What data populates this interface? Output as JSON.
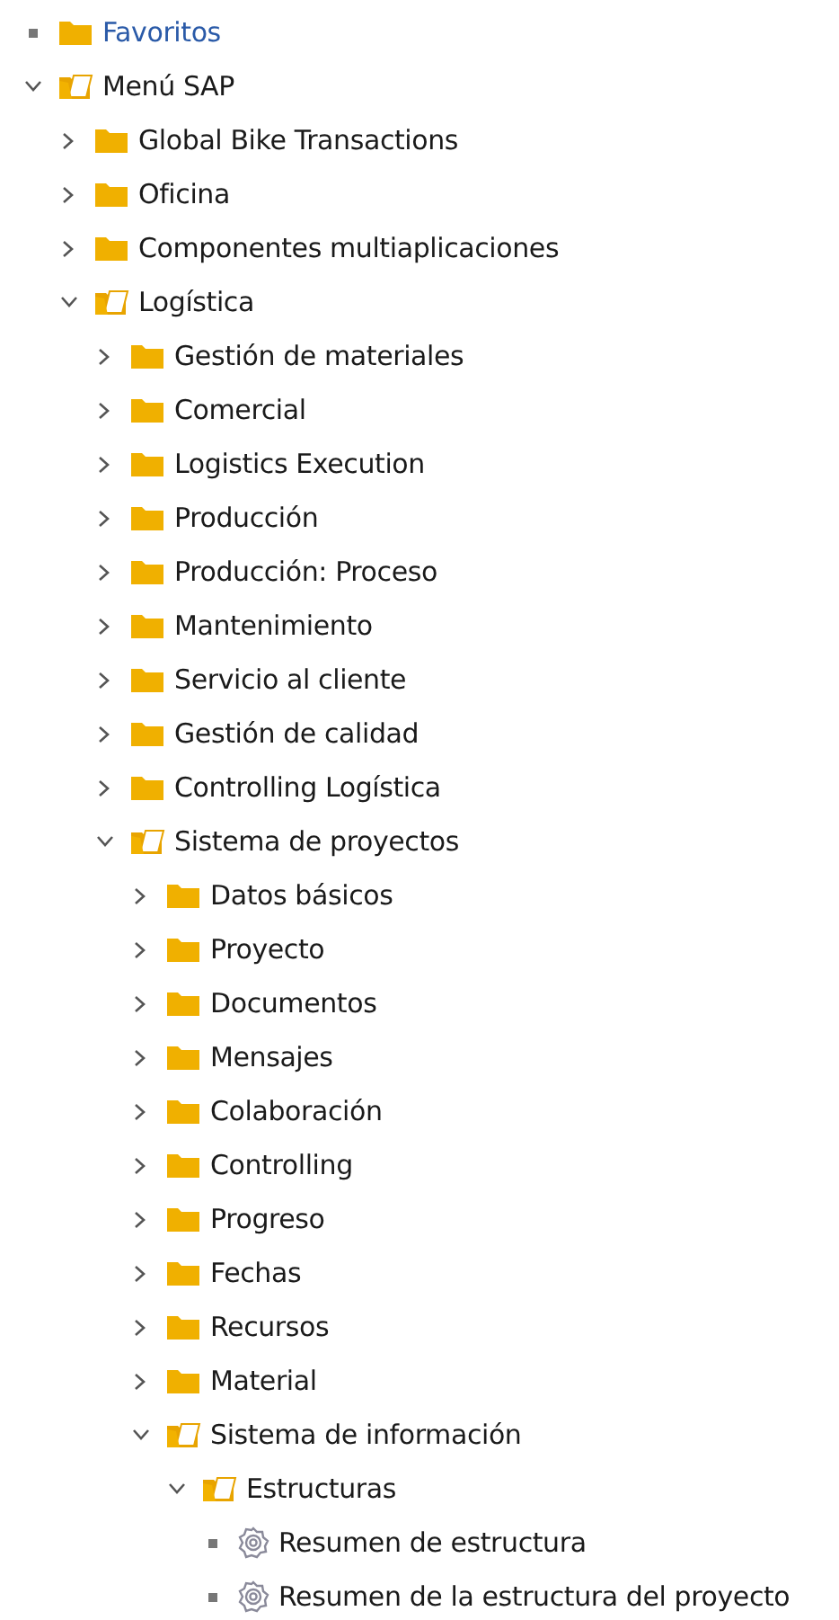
{
  "tree": [
    {
      "kind": "favorites",
      "label": "Favoritos"
    },
    {
      "kind": "folder",
      "label": "Menú SAP",
      "expanded": true,
      "children": [
        {
          "kind": "folder",
          "label": "Global Bike Transactions",
          "expanded": false
        },
        {
          "kind": "folder",
          "label": "Oficina",
          "expanded": false
        },
        {
          "kind": "folder",
          "label": "Componentes multiaplicaciones",
          "expanded": false
        },
        {
          "kind": "folder",
          "label": "Logística",
          "expanded": true,
          "children": [
            {
              "kind": "folder",
              "label": "Gestión de materiales",
              "expanded": false
            },
            {
              "kind": "folder",
              "label": "Comercial",
              "expanded": false
            },
            {
              "kind": "folder",
              "label": "Logistics Execution",
              "expanded": false
            },
            {
              "kind": "folder",
              "label": "Producción",
              "expanded": false
            },
            {
              "kind": "folder",
              "label": "Producción: Proceso",
              "expanded": false
            },
            {
              "kind": "folder",
              "label": "Mantenimiento",
              "expanded": false
            },
            {
              "kind": "folder",
              "label": "Servicio al cliente",
              "expanded": false
            },
            {
              "kind": "folder",
              "label": "Gestión de calidad",
              "expanded": false
            },
            {
              "kind": "folder",
              "label": "Controlling Logística",
              "expanded": false
            },
            {
              "kind": "folder",
              "label": "Sistema de proyectos",
              "expanded": true,
              "children": [
                {
                  "kind": "folder",
                  "label": "Datos básicos",
                  "expanded": false
                },
                {
                  "kind": "folder",
                  "label": "Proyecto",
                  "expanded": false
                },
                {
                  "kind": "folder",
                  "label": "Documentos",
                  "expanded": false
                },
                {
                  "kind": "folder",
                  "label": "Mensajes",
                  "expanded": false
                },
                {
                  "kind": "folder",
                  "label": "Colaboración",
                  "expanded": false
                },
                {
                  "kind": "folder",
                  "label": "Controlling",
                  "expanded": false
                },
                {
                  "kind": "folder",
                  "label": "Progreso",
                  "expanded": false
                },
                {
                  "kind": "folder",
                  "label": "Fechas",
                  "expanded": false
                },
                {
                  "kind": "folder",
                  "label": "Recursos",
                  "expanded": false
                },
                {
                  "kind": "folder",
                  "label": "Material",
                  "expanded": false
                },
                {
                  "kind": "folder",
                  "label": "Sistema de información",
                  "expanded": true,
                  "children": [
                    {
                      "kind": "folder",
                      "label": "Estructuras",
                      "expanded": true,
                      "children": [
                        {
                          "kind": "transaction",
                          "label": "Resumen de estructura"
                        },
                        {
                          "kind": "transaction",
                          "label": "Resumen de la estructura del proyecto"
                        }
                      ]
                    }
                  ]
                }
              ]
            }
          ]
        }
      ]
    }
  ]
}
